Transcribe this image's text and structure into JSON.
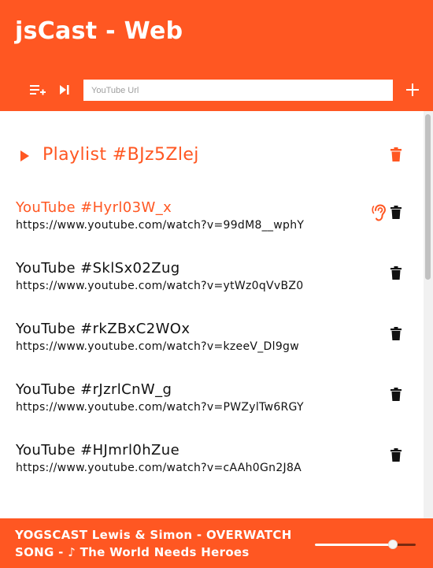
{
  "app": {
    "title": "jsCast - Web"
  },
  "toolbar": {
    "url_input": {
      "placeholder": "YouTube Url",
      "value": ""
    },
    "icons": [
      "playlist-add-icon",
      "skip-next-icon",
      "add-icon"
    ]
  },
  "playlist": {
    "label": "Playlist #BJz5Zlej",
    "icon": "play-arrow-icon"
  },
  "tracks": [
    {
      "title": "YouTube #Hyrl03W_x",
      "url": "https://www.youtube.com/watch?v=99dM8__wphY",
      "active": true
    },
    {
      "title": "YouTube #SklSx02Zug",
      "url": "https://www.youtube.com/watch?v=ytWz0qVvBZ0",
      "active": false
    },
    {
      "title": "YouTube #rkZBxC2WOx",
      "url": "https://www.youtube.com/watch?v=kzeeV_Dl9gw",
      "active": false
    },
    {
      "title": "YouTube #rJzrlCnW_g",
      "url": "https://www.youtube.com/watch?v=PWZylTw6RGY",
      "active": false
    },
    {
      "title": "YouTube #HJmrl0hZue",
      "url": "https://www.youtube.com/watch?v=cAAh0Gn2J8A",
      "active": false
    }
  ],
  "footer": {
    "now_playing": "YOGSCAST Lewis & Simon - OVERWATCH SONG - ♪ The World Needs Heroes",
    "volume": 0.77
  },
  "colors": {
    "accent": "#ff5722",
    "text": "#111111",
    "white": "#ffffff"
  }
}
